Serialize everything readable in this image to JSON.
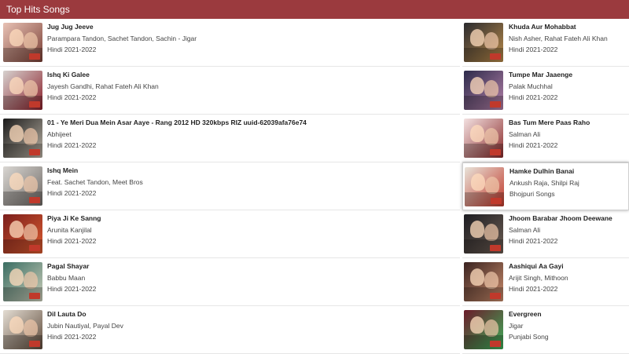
{
  "header": {
    "title": "Top Hits Songs"
  },
  "left": [
    {
      "title": "Jug Jug Jeeve",
      "artist": "Parampara Tandon, Sachet Tandon, Sachin - Jigar",
      "category": "Hindi 2021-2022",
      "colors": [
        "#e8c2b5",
        "#7a3f35"
      ]
    },
    {
      "title": "Ishq Ki Galee",
      "artist": "Jayesh Gandhi, Rahat Fateh Ali Khan",
      "category": "Hindi 2021-2022",
      "colors": [
        "#d7d2cf",
        "#8a1f2a"
      ]
    },
    {
      "title": "01 - Ye Meri Dua Mein Asar Aaye - Rang 2012 HD 320kbps RIZ uuid-62039afa76e74",
      "artist": "Abhijeet",
      "category": "Hindi 2021-2022",
      "colors": [
        "#1a1a1a",
        "#b9b1a4"
      ]
    },
    {
      "title": "Ishq Mein",
      "artist": "Feat. Sachet Tandon, Meet Bros",
      "category": "Hindi 2021-2022",
      "colors": [
        "#d9d6d2",
        "#6f6a66"
      ]
    },
    {
      "title": "Piya Ji Ke Sanng",
      "artist": "Arunita Kanjilal",
      "category": "Hindi 2021-2022",
      "colors": [
        "#7b1f1c",
        "#d85a2f"
      ]
    },
    {
      "title": "Pagal Shayar",
      "artist": "Babbu Maan",
      "category": "Hindi 2021-2022",
      "colors": [
        "#3b6e63",
        "#c9ccb8"
      ]
    },
    {
      "title": "Dil Lauta Do",
      "artist": "Jubin Nautiyal, Payal Dev",
      "category": "Hindi 2021-2022",
      "colors": [
        "#e4ddd3",
        "#5e4a3a"
      ]
    }
  ],
  "right": [
    {
      "title": "Khuda Aur Mohabbat",
      "artist": "Nish Asher, Rahat Fateh Ali Khan",
      "category": "Hindi 2021-2022",
      "colors": [
        "#2a2a2e",
        "#b88a4a"
      ]
    },
    {
      "title": "Tumpe Mar Jaaenge",
      "artist": "Palak Muchhal",
      "category": "Hindi 2021-2022",
      "colors": [
        "#2c2a4a",
        "#b27fa7"
      ]
    },
    {
      "title": "Bas Tum Mere Paas Raho",
      "artist": "Salman Ali",
      "category": "Hindi 2021-2022",
      "colors": [
        "#f3e1e1",
        "#8a2b2b"
      ]
    },
    {
      "title": "Hamke Dulhin Banai",
      "artist": "Ankush Raja, Shilpi Raj",
      "category": "Bhojpuri Songs",
      "colors": [
        "#e8e3d9",
        "#c0392b"
      ]
    },
    {
      "title": "Jhoom Barabar Jhoom Deewane",
      "artist": "Salman Ali",
      "category": "Hindi 2021-2022",
      "colors": [
        "#1d1d22",
        "#6b5c52"
      ]
    },
    {
      "title": "Aashiqui Aa Gayi",
      "artist": "Arijit Singh, Mithoon",
      "category": "Hindi 2021-2022",
      "colors": [
        "#3a2320",
        "#c78a6a"
      ]
    },
    {
      "title": "Evergreen",
      "artist": "Jigar",
      "category": "Punjabi Song",
      "colors": [
        "#6b1b2a",
        "#3fae5a"
      ]
    }
  ],
  "highlighted": "Hamke Dulhin Banai"
}
